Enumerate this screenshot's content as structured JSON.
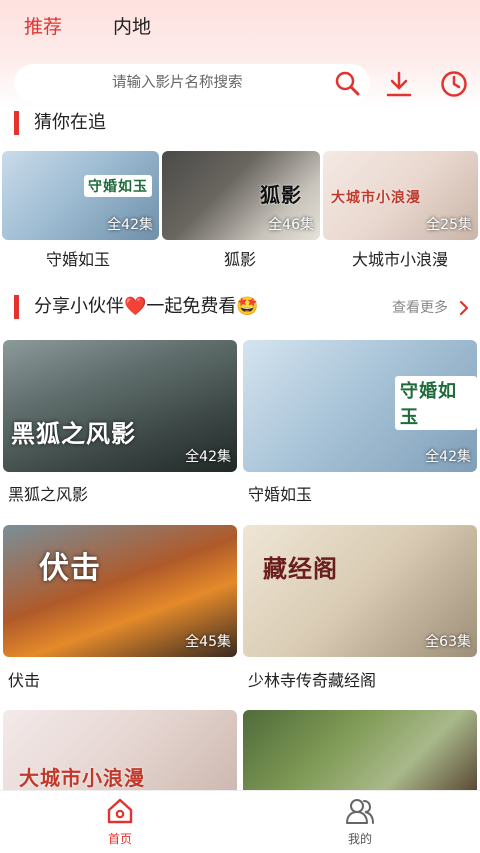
{
  "colors": {
    "accent": "#e2332f"
  },
  "tabs": [
    {
      "label": "推荐",
      "active": true
    },
    {
      "label": "内地",
      "active": false
    }
  ],
  "search": {
    "placeholder": "请输入影片名称搜索",
    "icon": "search-icon"
  },
  "header_actions": [
    {
      "icon": "download-icon"
    },
    {
      "icon": "history-clock-icon"
    }
  ],
  "section1": {
    "title": "猜你在追",
    "items": [
      {
        "title": "守婚如玉",
        "badge": "全42集",
        "poster_text": "守婚如玉"
      },
      {
        "title": "狐影",
        "badge": "全46集",
        "poster_text": "狐影"
      },
      {
        "title": "大城市小浪漫",
        "badge": "全25集",
        "poster_text": "大城市小浪漫"
      }
    ]
  },
  "section2": {
    "title": "分享小伙伴❤️一起免费看🤩",
    "more": "查看更多",
    "items": [
      {
        "title": "黑狐之风影",
        "badge": "全42集",
        "poster_text": "黑狐之风影"
      },
      {
        "title": "守婚如玉",
        "badge": "全42集",
        "poster_text": "守婚如玉"
      },
      {
        "title": "伏击",
        "badge": "全45集",
        "poster_text": "伏击"
      },
      {
        "title": "少林寺传奇藏经阁",
        "badge": "全63集",
        "poster_text": "藏经阁"
      },
      {
        "title": "",
        "badge": "",
        "poster_text": "大城市小浪漫"
      },
      {
        "title": "",
        "badge": "",
        "poster_text": ""
      }
    ]
  },
  "bottom_nav": [
    {
      "label": "首页",
      "icon": "home-icon",
      "active": true
    },
    {
      "label": "我的",
      "icon": "profile-icon",
      "active": false
    }
  ]
}
